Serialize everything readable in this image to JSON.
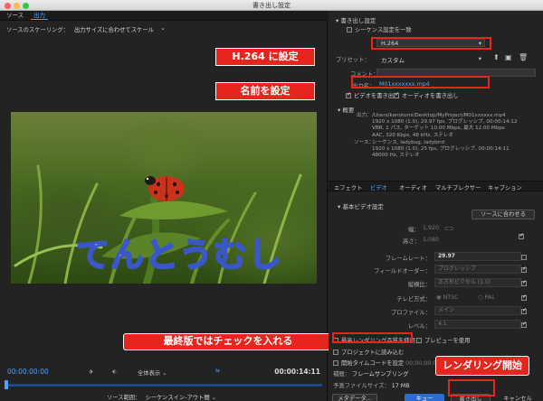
{
  "window": {
    "title": "書き出し設定"
  },
  "left": {
    "tabs": [
      {
        "label": "ソース"
      },
      {
        "label": "出力"
      }
    ],
    "scaling_label": "ソースのスケーリング：",
    "scaling_value": "出力サイズに合わせてスケール",
    "caption": "てんとうむし"
  },
  "timeline": {
    "timecode_start": "00:00:00:00",
    "timecode_end": "00:00:14:11",
    "zoom": "全体表示",
    "range_label": "ソース範囲：",
    "range_value": "シーケンスイン-アウト間"
  },
  "settings": {
    "section_title": "書き出し設定",
    "match_sequence": "シーケンス設定を一致",
    "format_label": "形式：",
    "format_value": "H.264",
    "preset_label": "プリセット：",
    "preset_value": "カスタム",
    "comment_label": "コメント：",
    "output_label": "出力名：",
    "output_value": "M01xxxxxxx.mp4",
    "export_video": "ビデオを書き出し",
    "export_audio": "オーディオを書き出し",
    "summary_title": "概要",
    "output_summary_label": "出力：",
    "output_summary": [
      "/Users/kanotomi/Desktop/MyProject/M01xxxxxx.mp4",
      "1920 x 1080 (1.0), 29.97 fps, プログレッシブ, 00:00:14:12",
      "VBR, 1 パス, ターゲット 10.00 Mbps, 最大 12.00 Mbps",
      "AAC, 320 Kbps, 48 kHz, ステレオ"
    ],
    "source_summary_label": "ソース：",
    "source_summary": [
      "シーケンス, ladybug, ladybird",
      "1920 x 1080 (1.0), 25 fps, プログレッシブ, 00:00:14:11",
      "48000 Hz, ステレオ"
    ]
  },
  "panel_tabs": [
    {
      "label": "エフェクト"
    },
    {
      "label": "ビデオ"
    },
    {
      "label": "オーディオ"
    },
    {
      "label": "マルチプレクサー"
    },
    {
      "label": "キャプション"
    }
  ],
  "video_settings": {
    "section_title": "基本ビデオ設定",
    "match_source_button": "ソースに合わせる",
    "width_label": "幅：",
    "width_value": "1,920",
    "height_label": "高さ：",
    "height_value": "1,080",
    "framerate_label": "フレームレート：",
    "framerate_value": "29.97",
    "field_order_label": "フィールドオーダー：",
    "field_order_value": "プログレッシブ",
    "aspect_label": "縦横比：",
    "aspect_value": "正方形ピクセル (1.0)",
    "tv_label": "テレビ方式：",
    "tv_ntsc": "NTSC",
    "tv_pal": "PAL",
    "profile_label": "プロファイル：",
    "profile_value": "メイン",
    "level_label": "レベル：",
    "level_value": "4.1"
  },
  "bottom": {
    "max_quality": "最高レンダリング品質を使用",
    "use_preview": "プレビューを使用",
    "import_project": "プロジェクトに読み込む",
    "set_start_tc": "開始タイムコードを設定",
    "start_tc_value": "00;00;00;00",
    "interp_label": "補間：",
    "interp_value": "フレームサンプリング",
    "filesize_label": "予測ファイルサイズ：",
    "filesize_value": "17 MB",
    "metadata_button": "メタデータ...",
    "queue_button": "キュー",
    "export_button": "書き出し",
    "cancel_button": "キャンセル"
  },
  "callouts": {
    "format": "H.264 に設定",
    "name": "名前を設定",
    "quality": "最終版ではチェックを入れる",
    "render": "レンダリング開始"
  },
  "colors": {
    "accent": "#4aa3ff",
    "callout": "#e6251f",
    "primary_button": "#2a6fd0"
  }
}
